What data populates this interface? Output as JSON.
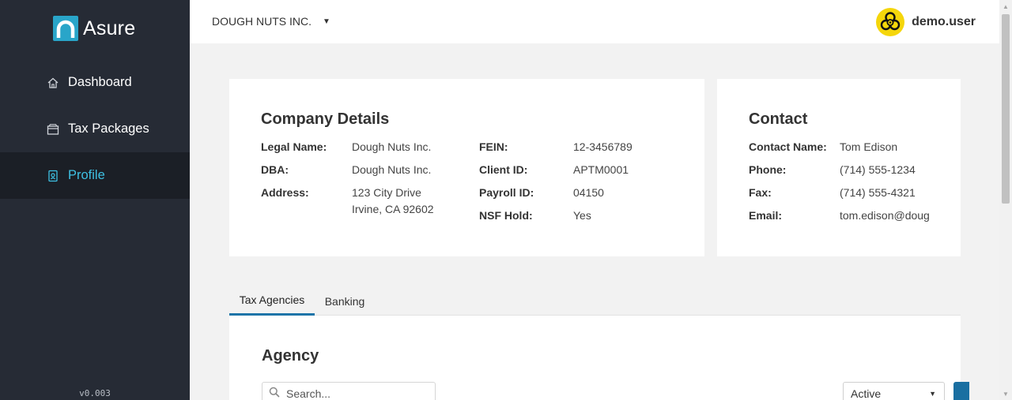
{
  "app": {
    "name": "Asure",
    "version": "v0.003"
  },
  "sidebar": {
    "items": [
      {
        "label": "Dashboard",
        "icon": "home-icon"
      },
      {
        "label": "Tax Packages",
        "icon": "package-icon"
      },
      {
        "label": "Profile",
        "icon": "profile-badge-icon",
        "active": true
      }
    ]
  },
  "topbar": {
    "company": "DOUGH NUTS INC.",
    "username": "demo.user",
    "avatar_icon": "biohazard-icon"
  },
  "company_details": {
    "title": "Company Details",
    "legal_name_label": "Legal Name:",
    "legal_name": "Dough Nuts Inc.",
    "dba_label": "DBA:",
    "dba": "Dough Nuts Inc.",
    "address_label": "Address:",
    "address_line1": "123 City Drive",
    "address_line2": "Irvine, CA 92602",
    "fein_label": "FEIN:",
    "fein": "12-3456789",
    "client_id_label": "Client ID:",
    "client_id": "APTM0001",
    "payroll_id_label": "Payroll ID:",
    "payroll_id": "04150",
    "nsf_hold_label": "NSF Hold:",
    "nsf_hold": "Yes"
  },
  "contact": {
    "title": "Contact",
    "name_label": "Contact Name:",
    "name": "Tom Edison",
    "phone_label": "Phone:",
    "phone": "(714) 555-1234",
    "fax_label": "Fax:",
    "fax": "(714) 555-4321",
    "email_label": "Email:",
    "email": "tom.edison@doug"
  },
  "tabs": [
    {
      "label": "Tax Agencies",
      "active": true
    },
    {
      "label": "Banking",
      "active": false
    }
  ],
  "agency": {
    "title": "Agency",
    "search_placeholder": "Search...",
    "status_filter": "Active"
  },
  "colors": {
    "sidebar_bg": "#262b35",
    "active_nav_bg": "#1b1f26",
    "accent": "#3ec0e3",
    "primary_button": "#1a6fa1"
  }
}
